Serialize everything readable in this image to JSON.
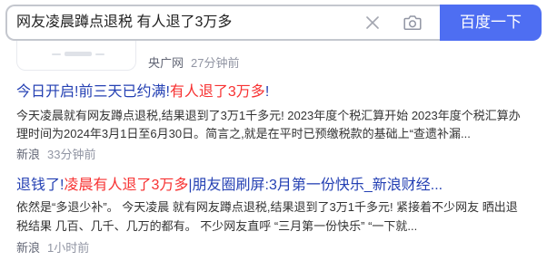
{
  "colors": {
    "brand_blue": "#4e6ef2",
    "title_blue": "#2440b3",
    "highlight_red": "#f73131",
    "text": "#333333",
    "meta_gray": "#9195a3"
  },
  "search": {
    "query": "网友凌晨蹲点退税 有人退了3万多",
    "submit_label": "百度一下",
    "clear_icon": "close-icon",
    "camera_icon": "camera-icon"
  },
  "results": [
    {
      "source": "央广网",
      "time": "27分钟前"
    },
    {
      "title": [
        {
          "text": "今日开启!前三天已约满!",
          "highlight": false
        },
        {
          "text": "有人退了3万多",
          "highlight": true
        },
        {
          "text": "!",
          "highlight": false
        }
      ],
      "abstract_lines": [
        "今天凌晨就有网友蹲点退税,结果退到了3万1千多元! 2023年度个税汇算开始 2023年度个税汇算办",
        "理时间为2024年3月1日至6月30日。简言之,就是在平时已预缴税款的基础上“查遗补漏..."
      ],
      "source": "新浪",
      "time": "33分钟前"
    },
    {
      "title": [
        {
          "text": "退钱了!",
          "highlight": false
        },
        {
          "text": "凌晨有人退了3万多",
          "highlight": true
        },
        {
          "text": "|朋友圈刷屏:3月第一份快乐_新浪财经...",
          "highlight": false
        }
      ],
      "abstract_lines": [
        "依然是“多退少补”。 今天凌晨 就有网友蹲点退税,结果退到了3万1千多元! 紧接着不少网友 晒出退",
        "税结果 几百、几千、几万的都有。 不少网友直呼 “三月第一份快乐” “一下就..."
      ],
      "source": "新浪",
      "time": "1小时前"
    }
  ]
}
